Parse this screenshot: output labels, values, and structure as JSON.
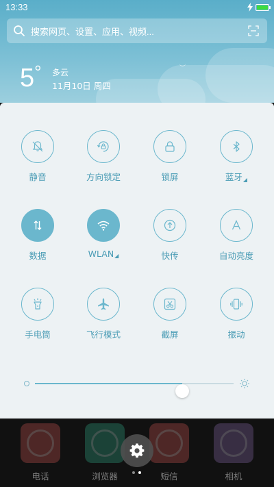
{
  "status_bar": {
    "time": "13:33"
  },
  "search": {
    "placeholder": "搜索网页、设置、应用、视频..."
  },
  "weather": {
    "temperature": "5",
    "unit": "°",
    "condition": "多云",
    "date": "11月10日 周四"
  },
  "toggles": [
    {
      "label": "静音",
      "icon": "bell-off-icon",
      "on": false,
      "has_menu": false
    },
    {
      "label": "方向锁定",
      "icon": "rotation-lock-icon",
      "on": false,
      "has_menu": false
    },
    {
      "label": "锁屏",
      "icon": "lock-icon",
      "on": false,
      "has_menu": false
    },
    {
      "label": "蓝牙",
      "icon": "bluetooth-icon",
      "on": false,
      "has_menu": true
    },
    {
      "label": "数据",
      "icon": "data-arrows-icon",
      "on": true,
      "has_menu": false
    },
    {
      "label": "WLAN",
      "icon": "wifi-icon",
      "on": true,
      "has_menu": true
    },
    {
      "label": "快传",
      "icon": "quick-transfer-icon",
      "on": false,
      "has_menu": false
    },
    {
      "label": "自动亮度",
      "icon": "auto-brightness-icon",
      "on": false,
      "has_menu": false
    },
    {
      "label": "手电筒",
      "icon": "flashlight-icon",
      "on": false,
      "has_menu": false
    },
    {
      "label": "飞行模式",
      "icon": "airplane-icon",
      "on": false,
      "has_menu": false
    },
    {
      "label": "截屏",
      "icon": "screenshot-icon",
      "on": false,
      "has_menu": false
    },
    {
      "label": "振动",
      "icon": "vibrate-icon",
      "on": false,
      "has_menu": false
    }
  ],
  "brightness": {
    "level": 0.74
  },
  "dock": [
    {
      "label": "电话",
      "color": "#c0504d"
    },
    {
      "label": "浏览器",
      "color": "#2f9e7e"
    },
    {
      "label": "短信",
      "color": "#c0504d"
    },
    {
      "label": "相机",
      "color": "#8064a2"
    }
  ],
  "colors": {
    "accent": "#6bb7cd",
    "label": "#4a9cb5",
    "panel": "#edf2f4"
  }
}
